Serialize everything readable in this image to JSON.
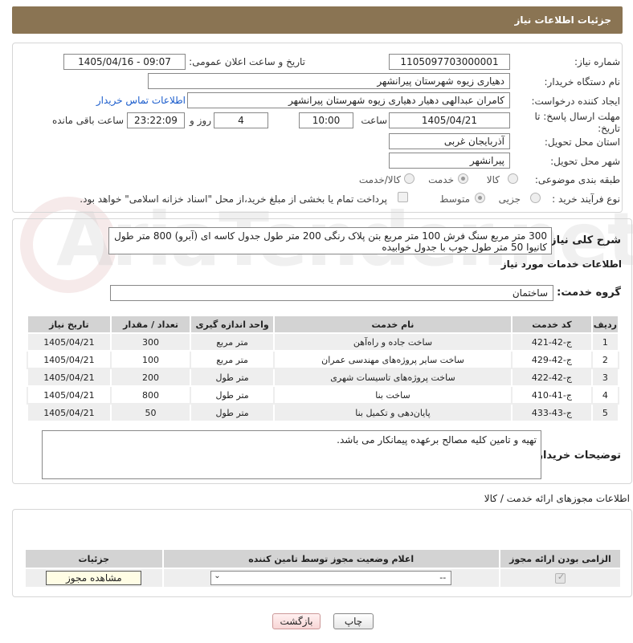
{
  "header": {
    "title": "جزئیات اطلاعات نیاز"
  },
  "info": {
    "need_number_label": "شماره نیاز:",
    "need_number": "1105097703000001",
    "announce_label": "تاریخ و ساعت اعلان عمومی:",
    "announce_value": "1405/04/16 - 09:07",
    "buyer_org_label": "نام دستگاه خریدار:",
    "buyer_org": "دهیاری زیوه شهرستان پیرانشهر",
    "creator_label": "ایجاد کننده درخواست:",
    "creator": "کامران عبدالهی دهیار دهیاری زیوه شهرستان پیرانشهر",
    "contact_link": "اطلاعات تماس خریدار",
    "deadline_label": "مهلت ارسال پاسخ: تا تاریخ:",
    "deadline_date": "1405/04/21",
    "time_label": "ساعت",
    "deadline_time": "10:00",
    "days_value": "4",
    "days_label": "روز و",
    "remaining_time": "23:22:09",
    "remaining_label": "ساعت باقی مانده",
    "province_label": "استان محل تحویل:",
    "province": "آذربایجان غربی",
    "city_label": "شهر محل تحویل:",
    "city": "پیرانشهر",
    "category_label": "طبقه بندی موضوعی:",
    "category_options": [
      "کالا",
      "خدمت",
      "کالا/خدمت"
    ],
    "category_selected": "خدمت",
    "process_label": "نوع فرآیند خرید :",
    "process_options": [
      "جزیی",
      "متوسط"
    ],
    "process_selected": "جزیی",
    "payment_note": "پرداخت تمام یا بخشی از مبلغ خرید،از محل \"اسناد خزانه اسلامی\" خواهد بود."
  },
  "description": {
    "label": "شرح کلی نیاز:",
    "text": "300 متر مربع سنگ فرش 100 متر مربع بتن پلاک رنگی 200 متر طول جدول کاسه ای (آبرو) 800 متر طول کانیوا 50 متر طول جوب با جدول خوابیده"
  },
  "services": {
    "section_title": "اطلاعات خدمات مورد نیاز",
    "group_label": "گروه خدمت:",
    "group_value": "ساختمان",
    "columns": [
      "ردیف",
      "کد خدمت",
      "نام خدمت",
      "واحد اندازه گیری",
      "تعداد / مقدار",
      "تاریخ نیاز"
    ],
    "rows": [
      {
        "idx": "1",
        "code": "ج-42-421",
        "name": "ساخت جاده و راه‌آهن",
        "unit": "متر مربع",
        "qty": "300",
        "date": "1405/04/21"
      },
      {
        "idx": "2",
        "code": "ج-42-429",
        "name": "ساخت سایر پروژه‌های مهندسی عمران",
        "unit": "متر مربع",
        "qty": "100",
        "date": "1405/04/21"
      },
      {
        "idx": "3",
        "code": "ج-42-422",
        "name": "ساخت پروژه‌های تاسیسات شهری",
        "unit": "متر طول",
        "qty": "200",
        "date": "1405/04/21"
      },
      {
        "idx": "4",
        "code": "ج-41-410",
        "name": "ساخت بنا",
        "unit": "متر طول",
        "qty": "800",
        "date": "1405/04/21"
      },
      {
        "idx": "5",
        "code": "ج-43-433",
        "name": "پایان‌دهی و تکمیل بنا",
        "unit": "متر طول",
        "qty": "50",
        "date": "1405/04/21"
      }
    ]
  },
  "buyer_notes": {
    "label": "توضیحات خریدار:",
    "text": "تهیه و تامین کلیه مصالح برعهده پیمانکار می باشد."
  },
  "licenses": {
    "section_title": "اطلاعات مجوزهای ارائه خدمت / کالا",
    "columns": [
      "الزامی بودن ارائه مجوز",
      "اعلام وضعیت مجوز توسط تامین کننده",
      "جزئیات"
    ],
    "select_value": "--",
    "view_button": "مشاهده مجوز"
  },
  "footer": {
    "print_button": "چاپ",
    "back_button": "بازگشت"
  },
  "watermark": "AriaTender.net"
}
